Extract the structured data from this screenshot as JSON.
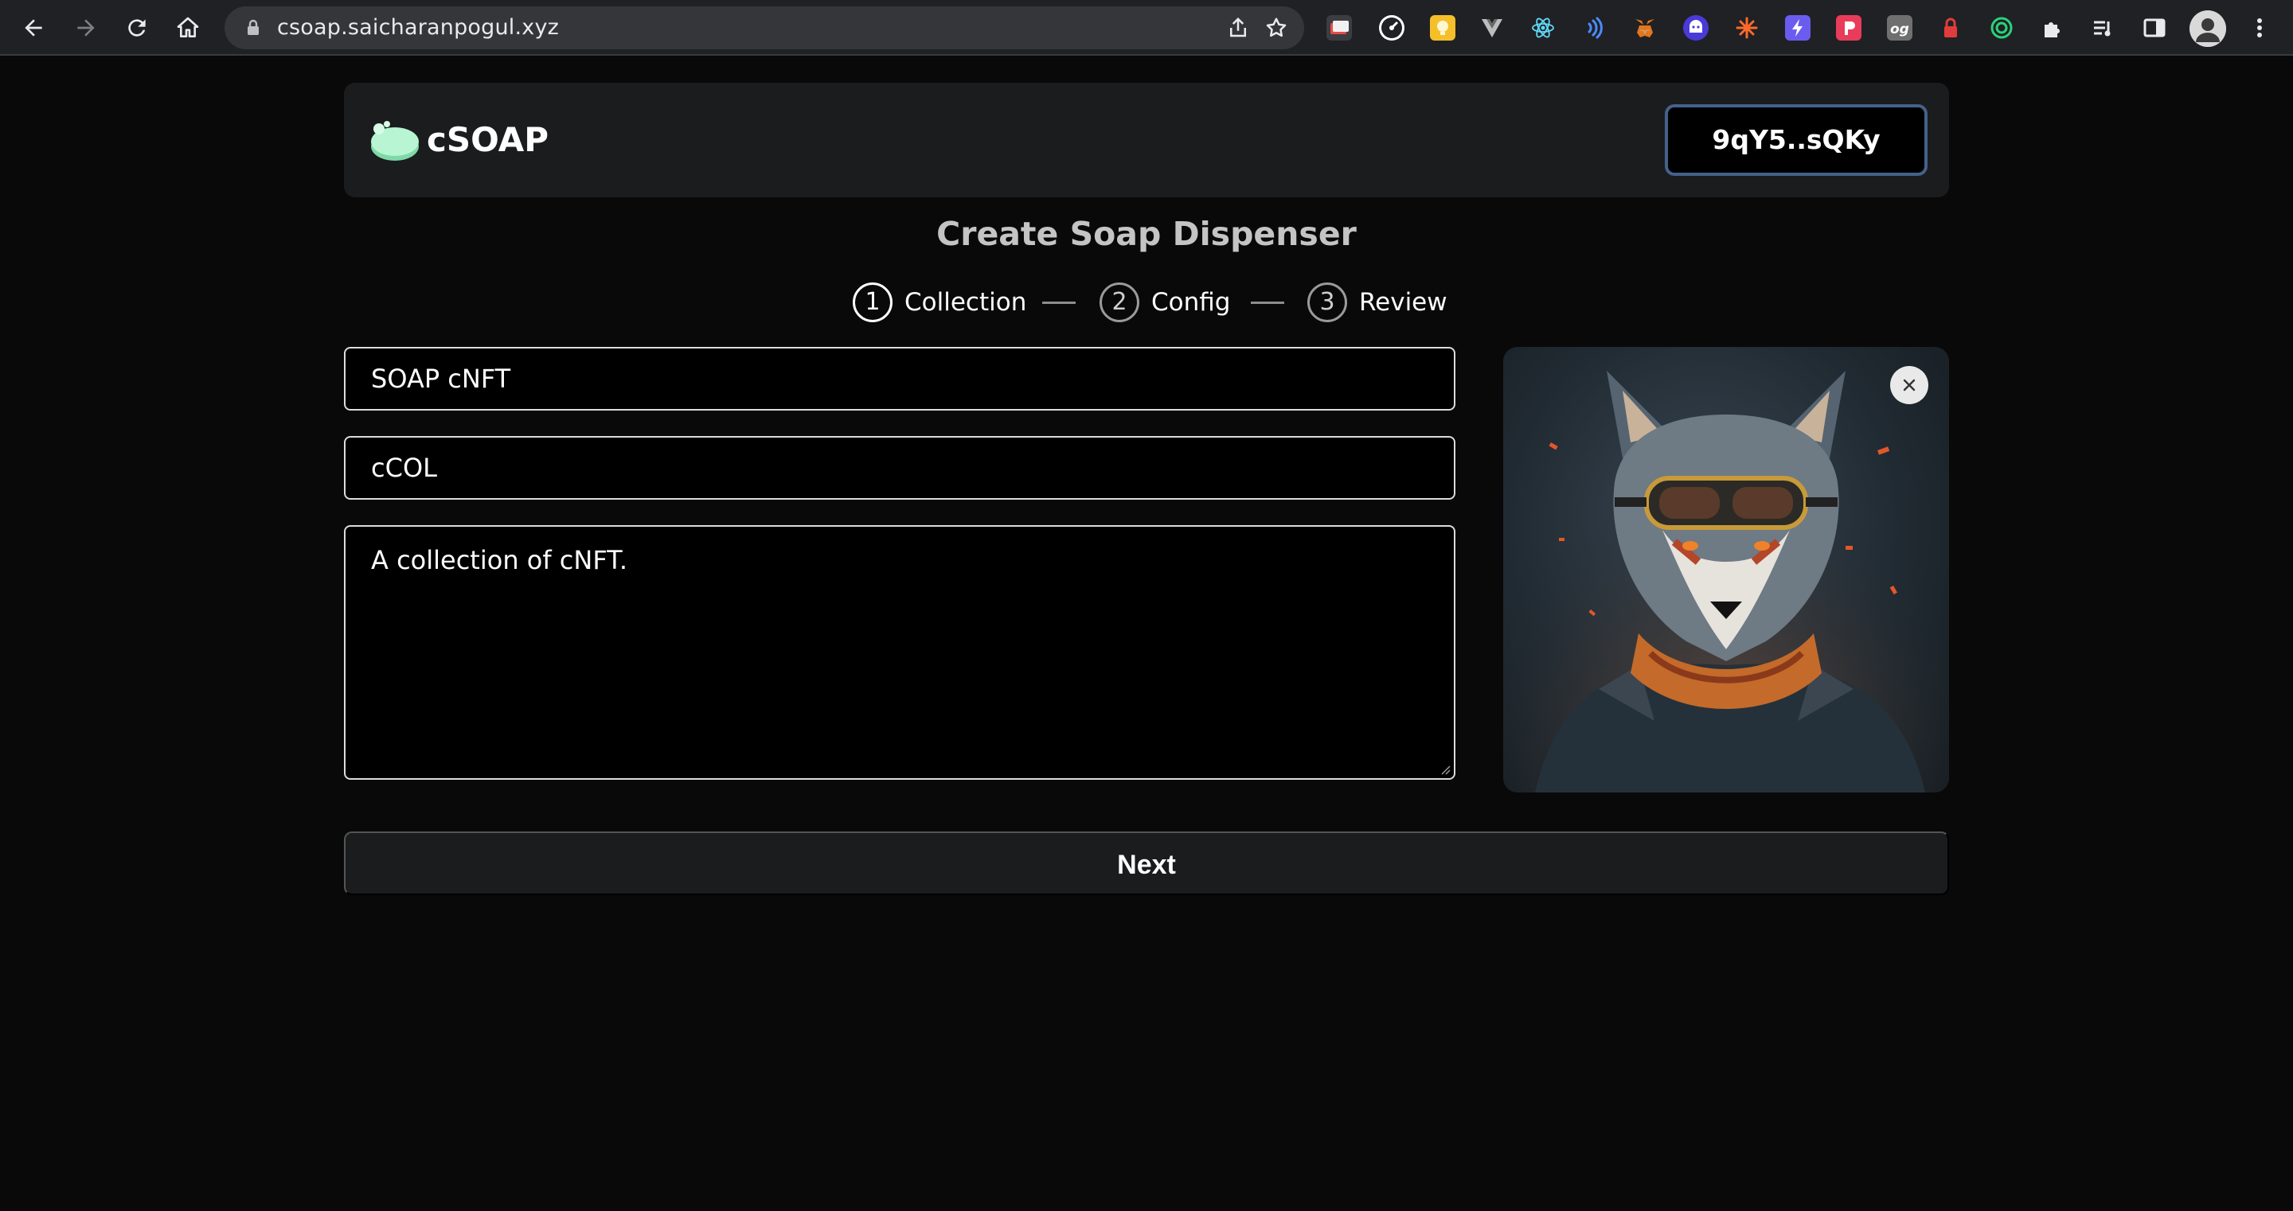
{
  "browser": {
    "url": "csoap.saicharanpogul.xyz",
    "icons": [
      "back-icon",
      "forward-icon",
      "reload-icon",
      "home-icon",
      "lock-icon",
      "share-icon",
      "bookmark-star-icon",
      "extensions-puzzle-icon",
      "reading-list-icon",
      "side-panel-icon",
      "profile-avatar",
      "more-menu-icon"
    ]
  },
  "header": {
    "brand": "cSOAP",
    "wallet_label": "9qY5..sQKy"
  },
  "page": {
    "title": "Create Soap Dispenser"
  },
  "stepper": {
    "steps": [
      {
        "number": "1",
        "label": "Collection",
        "active": true
      },
      {
        "number": "2",
        "label": "Config",
        "active": false
      },
      {
        "number": "3",
        "label": "Review",
        "active": false
      }
    ]
  },
  "form": {
    "name_value": "SOAP cNFT",
    "symbol_value": "cCOL",
    "description_value": "A collection of cNFT."
  },
  "actions": {
    "next_label": "Next"
  },
  "colors": {
    "background": "#090909",
    "card": "#1b1c1e",
    "wallet_border": "#43628a",
    "title": "#c4c4c4",
    "logo": "#a6f0c6"
  }
}
